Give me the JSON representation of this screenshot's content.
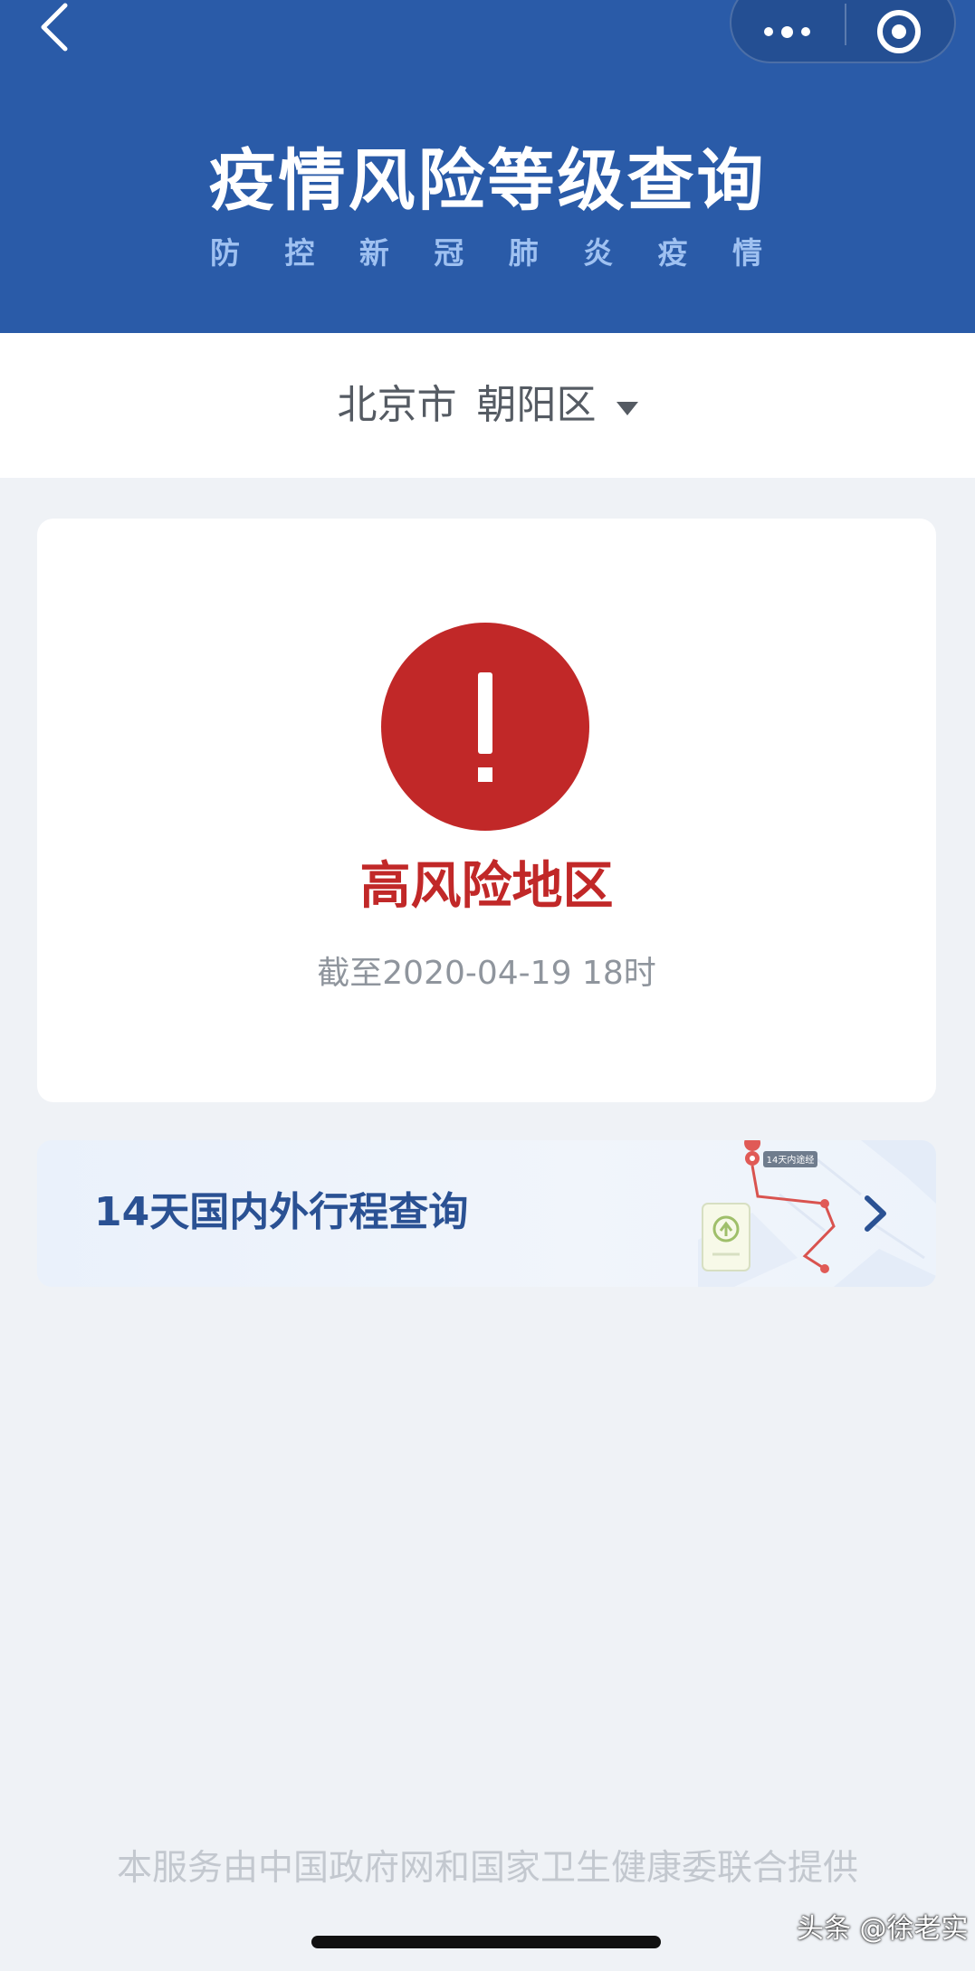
{
  "header": {
    "title": "疫情风险等级查询",
    "subtitle_chars": [
      "防",
      "控",
      "新",
      "冠",
      "肺",
      "炎",
      "疫",
      "情"
    ]
  },
  "location": {
    "city": "北京市",
    "district": "朝阳区"
  },
  "risk": {
    "level": "高风险地区",
    "timestamp": "截至2020-04-19 18时",
    "color": "#c12828"
  },
  "trip": {
    "label": "14天国内外行程查询",
    "illustration_tag": "14天内途经"
  },
  "footer": {
    "text": "本服务由中国政府网和国家卫生健康委联合提供"
  },
  "watermark": {
    "text": "头条 @徐老实"
  },
  "colors": {
    "header_bg": "#2a5ba8",
    "page_bg": "#eff2f6",
    "accent_red": "#c12828",
    "trip_text": "#2a5193"
  },
  "icons": {
    "back": "chevron-left-icon",
    "more": "more-dots-icon",
    "close": "target-circle-icon",
    "dropdown": "caret-down-icon",
    "alert": "exclamation-icon",
    "trip_arrow": "chevron-right-icon"
  }
}
